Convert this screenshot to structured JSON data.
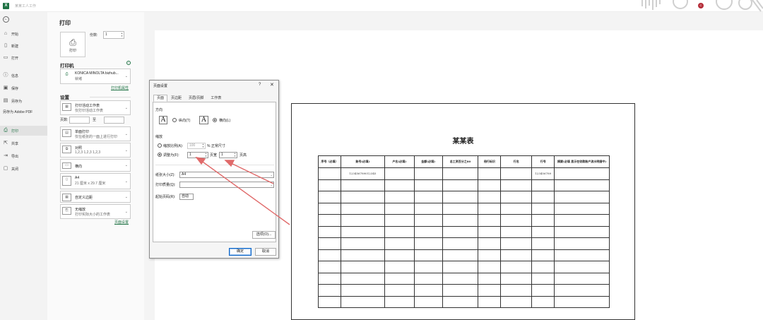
{
  "window": {
    "title": "某某工人工作"
  },
  "nav": {
    "items": [
      {
        "label": "开始",
        "icon": "home-icon"
      },
      {
        "label": "新建",
        "icon": "new-file-icon"
      },
      {
        "label": "打开",
        "icon": "folder-icon"
      },
      {
        "label": "信息",
        "icon": "info-icon"
      },
      {
        "label": "保存",
        "icon": "save-icon"
      },
      {
        "label": "另存为",
        "icon": "save-as-icon"
      },
      {
        "label": "另存为 Adobe PDF",
        "icon": ""
      },
      {
        "label": "打印",
        "icon": "print-icon"
      },
      {
        "label": "共享",
        "icon": "share-icon"
      },
      {
        "label": "导出",
        "icon": "export-icon"
      },
      {
        "label": "关闭",
        "icon": "close-file-icon"
      }
    ],
    "active": "打印"
  },
  "print_panel": {
    "heading": "打印",
    "print_button": "打印",
    "copies_label": "份数:",
    "copies_value": "1",
    "printer_section": "打印机",
    "printer_name": "KONICA MINOLTA bizhub...",
    "printer_status": "就绪",
    "printer_props_link": "打印机属性",
    "settings_section": "设置",
    "scope_main": "打印活动工作表",
    "scope_sub": "仅打印活动工作表",
    "pages_label": "页数:",
    "pages_to": "至",
    "sides_main": "单面打印",
    "sides_sub": "仅在纸张的一面上进行打印",
    "collate_main": "对照",
    "collate_sub": "1,2,3    1,2,3    1,2,3",
    "orientation": "横向",
    "paper_main": "A4",
    "paper_sub": "21 厘米 x 29.7 厘米",
    "margins": "自定义边距",
    "scaling_main": "无缩放",
    "scaling_sub": "打印实际大小的工作表",
    "page_setup_link": "页面设置"
  },
  "dialog": {
    "title": "页面设置",
    "help": "?",
    "close": "✕",
    "tabs": [
      "页面",
      "页边距",
      "页眉/页脚",
      "工作表"
    ],
    "orientation_label": "方向",
    "portrait": "纵向(T)",
    "landscape": "横向(L)",
    "scaling_label": "缩放",
    "adjust_to": "缩放比例(A):",
    "adjust_value": "100",
    "adjust_unit": "% 正常尺寸",
    "fit_to": "调整为(F):",
    "fit_wide": "1",
    "fit_wide_unit": "页宽",
    "fit_tall": "1",
    "fit_tall_unit": "页高",
    "paper_size_label": "纸张大小(Z):",
    "paper_size_value": "A4",
    "print_quality_label": "打印质量(Q):",
    "print_quality_value": "",
    "first_page_label": "起始页码(R):",
    "first_page_value": "自动",
    "options_button": "选项(O)...",
    "ok_button": "确定",
    "cancel_button": "取消"
  },
  "preview": {
    "sheet_title": "某某表",
    "columns": [
      "序号（必填）",
      "账号(必填)",
      "户名(必填)",
      "金额(必填)",
      "总工资百分之80",
      "冊行标识",
      "行名",
      "行号",
      "摘要(必填 显示在收款账户流水明细中)"
    ],
    "rows": [
      [
        "",
        "123456789012345",
        "",
        "",
        "",
        "",
        "",
        "123456789",
        ""
      ]
    ],
    "empty_rows": 11
  },
  "colors": {
    "accent": "#1f7244",
    "arrow": "#e06a6a"
  }
}
